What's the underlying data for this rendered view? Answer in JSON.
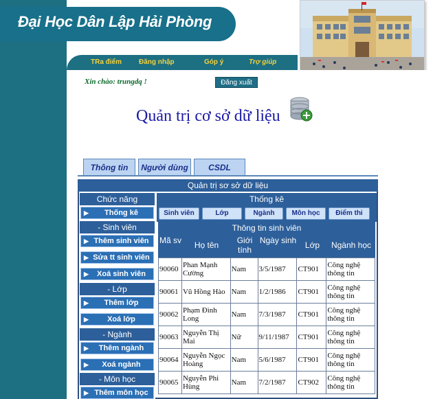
{
  "header": {
    "title": "Đại Học Dân Lập Hải Phòng"
  },
  "nav": {
    "items": [
      {
        "label": "TRa điểm"
      },
      {
        "label": "Đăng nhập"
      },
      {
        "label": "Góp ý"
      },
      {
        "label": "Trợ giúp"
      }
    ]
  },
  "user": {
    "greeting": "Xin chào: trungdq !",
    "logout_label": "Đăng xuất"
  },
  "page": {
    "title": "Quản trị cơ sở dữ liệu"
  },
  "tabs": [
    {
      "label": "Thông tin"
    },
    {
      "label": "Người dùng"
    },
    {
      "label": "CSDL"
    }
  ],
  "panel": {
    "title": "Quản trị sơ sở dữ liệu",
    "functions_title": "Chức năng",
    "sections": [
      {
        "type": "button",
        "label": "Thống kê"
      },
      {
        "type": "header",
        "label": "- Sinh viên"
      },
      {
        "type": "button",
        "label": "Thêm sinh viên"
      },
      {
        "type": "button",
        "label": "Sửa tt sinh viên"
      },
      {
        "type": "button",
        "label": "Xoá sinh viên"
      },
      {
        "type": "header",
        "label": "- Lớp"
      },
      {
        "type": "button",
        "label": "Thêm lớp"
      },
      {
        "type": "button",
        "label": "Xoá lớp"
      },
      {
        "type": "header",
        "label": "- Ngành"
      },
      {
        "type": "button",
        "label": "Thêm ngành"
      },
      {
        "type": "button",
        "label": "Xoá ngành"
      },
      {
        "type": "header",
        "label": "- Môn học"
      },
      {
        "type": "button",
        "label": "Thêm môn học"
      }
    ],
    "stats_title": "Thống kê",
    "stats_tabs": [
      {
        "label": "Sinh viên"
      },
      {
        "label": "Lớp"
      },
      {
        "label": "Ngành"
      },
      {
        "label": "Môn học"
      },
      {
        "label": "Điểm thi"
      }
    ],
    "info_title": "Thông tin sinh viên",
    "columns": [
      "Mã sv",
      "Họ tên",
      "Giới tính",
      "Ngày sinh",
      "Lớp",
      "Ngành học"
    ],
    "students": [
      {
        "id": "90060",
        "name": "Phan Mạnh Cường",
        "sex": "Nam",
        "dob": "3/5/1987",
        "class": "CT901",
        "major": "Công nghệ thông tin"
      },
      {
        "id": "90061",
        "name": "Vũ Hồng Hào",
        "sex": "Nam",
        "dob": "1/2/1986",
        "class": "CT901",
        "major": "Công nghệ thông tin"
      },
      {
        "id": "90062",
        "name": "Phạm Đình Long",
        "sex": "Nam",
        "dob": "7/3/1987",
        "class": "CT901",
        "major": "Công nghệ thông tin"
      },
      {
        "id": "90063",
        "name": "Nguyễn Thị Mai",
        "sex": "Nữ",
        "dob": "9/11/1987",
        "class": "CT901",
        "major": "Công nghệ thông tin"
      },
      {
        "id": "90064",
        "name": "Nguyễn Ngọc Hoàng",
        "sex": "Nam",
        "dob": "5/6/1987",
        "class": "CT901",
        "major": "Công nghệ thông tin"
      },
      {
        "id": "90065",
        "name": "Nguyễn Phi Hùng",
        "sex": "Nam",
        "dob": "7/2/1987",
        "class": "CT902",
        "major": "Công nghệ thông tin"
      }
    ]
  },
  "colors": {
    "teal": "#1d6f82",
    "panel_blue": "#2d5f9a",
    "button_blue": "#2b6fb5",
    "title_blue": "#1a1aa5",
    "nav_yellow": "#f4d23c",
    "greeting_green": "#0a6a2a"
  },
  "icons": [
    "database-add-icon",
    "arrow-right-icon"
  ]
}
